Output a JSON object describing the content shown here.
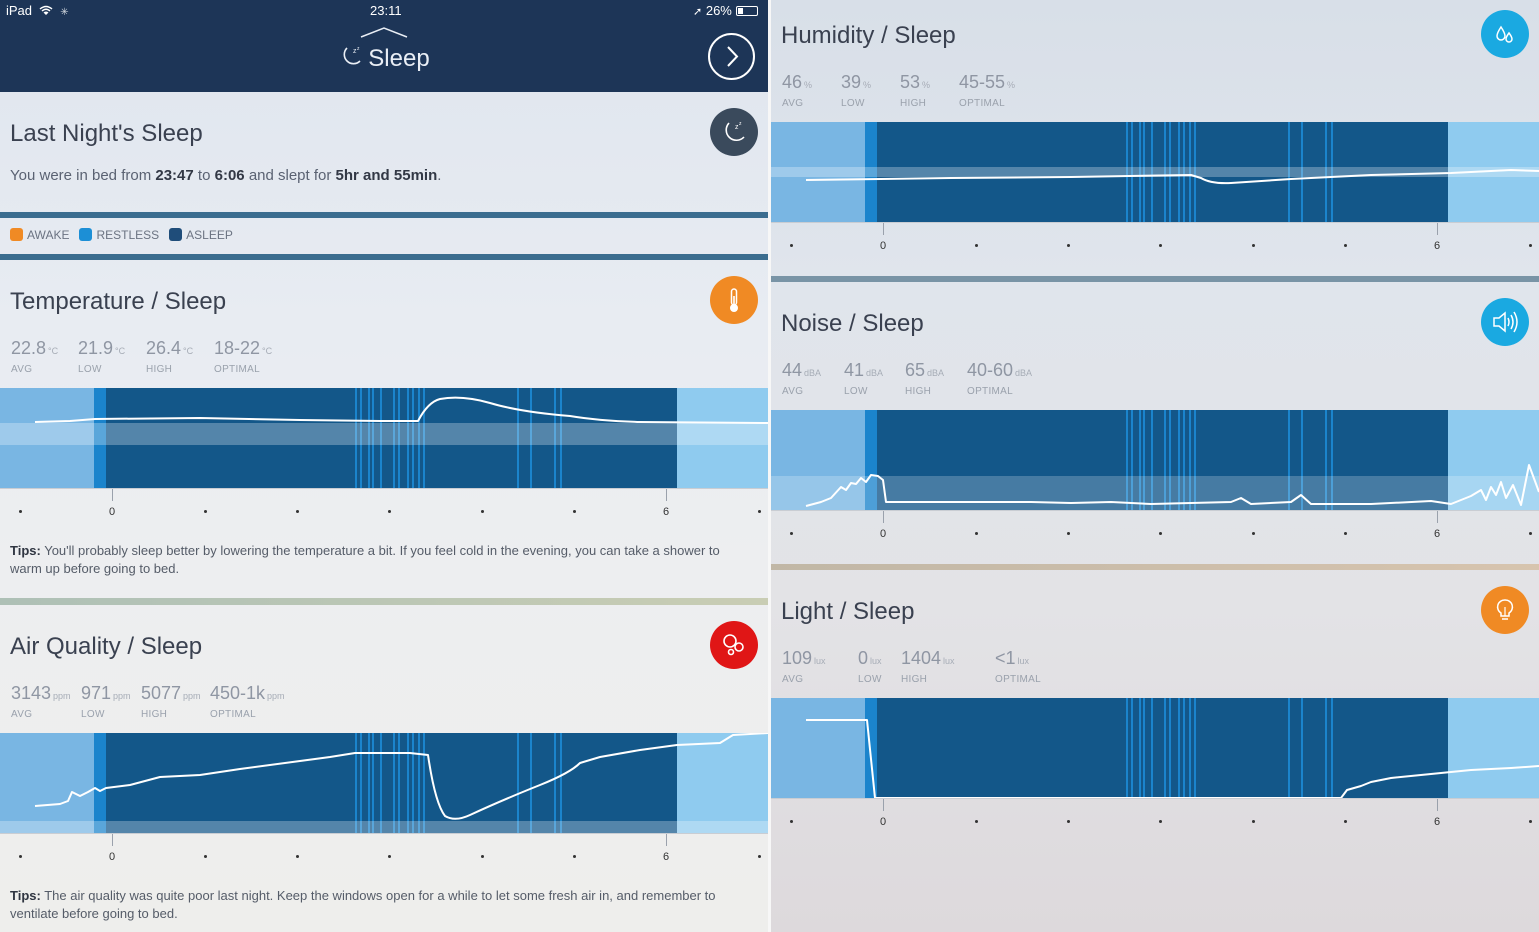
{
  "status": {
    "device": "iPad",
    "time": "23:11",
    "battery": "26%"
  },
  "header": {
    "title": "Sleep"
  },
  "last_night": {
    "title": "Last Night's Sleep",
    "desc_prefix": "You were in bed from",
    "start": "23:47",
    "to": "to",
    "end": "6:06",
    "desc_mid": "and slept for",
    "duration": "5hr and 55min",
    "desc_suffix": "."
  },
  "legend": [
    {
      "label": "AWAKE",
      "color": "#f08a24"
    },
    {
      "label": "RESTLESS",
      "color": "#1c8fd6"
    },
    {
      "label": "ASLEEP",
      "color": "#1f4d7a"
    }
  ],
  "colors": {
    "awake_bg": "#79b6e3",
    "asleep_bg": "#135789",
    "restless": "#1b84cc",
    "light_end": "#8fcbef",
    "temperature": "#f08a24",
    "air": "#e01616",
    "humidity": "#1aa9e1",
    "noise": "#1aa9e1",
    "light": "#f08a24",
    "moon": "#3a4a5c"
  },
  "panels": {
    "temperature": {
      "title": "Temperature / Sleep",
      "stats": [
        {
          "value": "22.8",
          "unit": "°C",
          "label": "AVG"
        },
        {
          "value": "21.9",
          "unit": "°C",
          "label": "LOW"
        },
        {
          "value": "26.4",
          "unit": "°C",
          "label": "HIGH"
        },
        {
          "value": "18-22",
          "unit": "°C",
          "label": "OPTIMAL"
        }
      ],
      "tips_label": "Tips:",
      "tips": "You'll probably sleep better by lowering the temperature a bit. If you feel cold in the evening, you can take a shower to warm up before going to bed."
    },
    "air": {
      "title": "Air Quality / Sleep",
      "stats": [
        {
          "value": "3143",
          "unit": "ppm",
          "label": "AVG"
        },
        {
          "value": "971",
          "unit": "ppm",
          "label": "LOW"
        },
        {
          "value": "5077",
          "unit": "ppm",
          "label": "HIGH"
        },
        {
          "value": "450-1k",
          "unit": "ppm",
          "label": "OPTIMAL"
        }
      ],
      "tips_label": "Tips:",
      "tips": "The air quality was quite poor last night. Keep the windows open for a while to let some fresh air in, and remember to ventilate before going to bed."
    },
    "humidity": {
      "title": "Humidity / Sleep",
      "stats": [
        {
          "value": "46",
          "unit": "%",
          "label": "AVG"
        },
        {
          "value": "39",
          "unit": "%",
          "label": "LOW"
        },
        {
          "value": "53",
          "unit": "%",
          "label": "HIGH"
        },
        {
          "value": "45-55",
          "unit": "%",
          "label": "OPTIMAL"
        }
      ]
    },
    "noise": {
      "title": "Noise / Sleep",
      "stats": [
        {
          "value": "44",
          "unit": "dBA",
          "label": "AVG"
        },
        {
          "value": "41",
          "unit": "dBA",
          "label": "LOW"
        },
        {
          "value": "65",
          "unit": "dBA",
          "label": "HIGH"
        },
        {
          "value": "40-60",
          "unit": "dBA",
          "label": "OPTIMAL"
        }
      ]
    },
    "light": {
      "title": "Light / Sleep",
      "stats": [
        {
          "value": "109",
          "unit": "lux",
          "label": "AVG"
        },
        {
          "value": "0",
          "unit": "lux",
          "label": "LOW"
        },
        {
          "value": "1404",
          "unit": "lux",
          "label": "HIGH"
        },
        {
          "value": "<1",
          "unit": "lux",
          "label": "OPTIMAL"
        }
      ]
    }
  },
  "axis": {
    "tick_labels": [
      "0",
      "6"
    ]
  }
}
